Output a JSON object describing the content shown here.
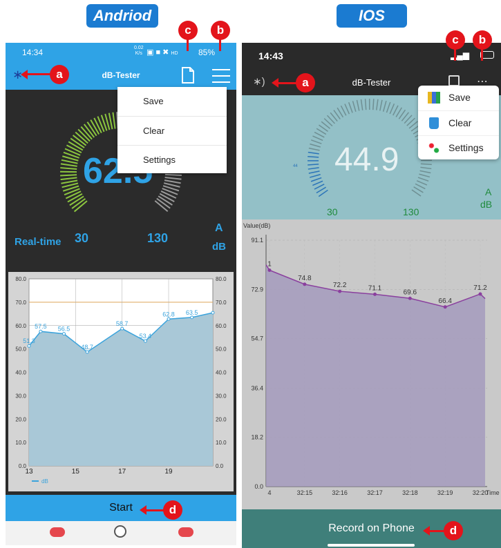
{
  "header": {
    "android_label": "Andriod",
    "ios_label": "IOS"
  },
  "markers": {
    "a": "a",
    "b": "b",
    "c": "c",
    "d": "d"
  },
  "android": {
    "status_time": "14:34",
    "status_speed_value": "0.02",
    "status_speed_unit": "K/s",
    "status_battery": "85%",
    "app_title": "dB-Tester",
    "reading": "62.5",
    "mode_label": "Real-time",
    "scale_min": "30",
    "scale_max": "130",
    "weighting": "A",
    "unit": "dB",
    "menu": [
      "Save",
      "Clear",
      "Settings"
    ],
    "start_label": "Start",
    "legend_label": "dB",
    "colors": {
      "accent": "#2fa3e6",
      "gauge_green": "#8cc63f",
      "line": "#3aa3dc"
    }
  },
  "ios": {
    "status_time": "14:43",
    "app_title": "dB-Tester",
    "reading": "44.9",
    "gauge_small_label": "44",
    "scale_min": "30",
    "scale_max": "130",
    "weighting": "A",
    "unit": "dB",
    "menu": [
      "Save",
      "Clear",
      "Settings"
    ],
    "record_label": "Record on Phone",
    "colors": {
      "accent": "#3f7f7a",
      "gauge_blue": "#2a73b8",
      "line": "#8a3f9e"
    }
  },
  "chart_data": [
    {
      "type": "area",
      "title": "",
      "ylabel": "",
      "xlabel": "",
      "ylim": [
        0,
        80
      ],
      "xlim": [
        13,
        20
      ],
      "y_ticks": [
        "0.0",
        "10.0",
        "20.0",
        "30.0",
        "40.0",
        "50.0",
        "60.0",
        "70.0",
        "80.0"
      ],
      "x_ticks": [
        "13",
        "15",
        "17",
        "19"
      ],
      "threshold": 70,
      "legend": "dB",
      "points": [
        {
          "x": 13.0,
          "y": 51.3,
          "label": "51.3"
        },
        {
          "x": 13.5,
          "y": 57.5,
          "label": "57.5"
        },
        {
          "x": 14.5,
          "y": 56.5,
          "label": "56.5"
        },
        {
          "x": 15.5,
          "y": 48.7,
          "label": "48.7"
        },
        {
          "x": 17.0,
          "y": 58.7,
          "label": "58.7"
        },
        {
          "x": 18.0,
          "y": 53.4,
          "label": "53.4"
        },
        {
          "x": 19.0,
          "y": 62.8,
          "label": "62.8"
        },
        {
          "x": 20.0,
          "y": 63.5,
          "label": "63.5"
        },
        {
          "x": 20.9,
          "y": 65.5,
          "label": ""
        }
      ]
    },
    {
      "type": "area",
      "title": "",
      "ylabel": "Value(dB)",
      "xlabel": "Time",
      "ylim": [
        0,
        91.1
      ],
      "y_ticks": [
        "0.0",
        "18.2",
        "36.4",
        "54.7",
        "72.9",
        "91.1"
      ],
      "x_ticks": [
        "4",
        "32:15",
        "32:16",
        "32:17",
        "32:18",
        "32:19",
        "32:20"
      ],
      "points": [
        {
          "x": "4",
          "y": 80.0,
          "label": "1"
        },
        {
          "x": "32:15",
          "y": 74.8,
          "label": "74.8"
        },
        {
          "x": "32:16",
          "y": 72.2,
          "label": "72.2"
        },
        {
          "x": "32:17",
          "y": 71.1,
          "label": "71.1"
        },
        {
          "x": "32:18",
          "y": 69.6,
          "label": "69.6"
        },
        {
          "x": "32:19",
          "y": 66.4,
          "label": "66.4"
        },
        {
          "x": "32:20",
          "y": 71.2,
          "label": "71.2"
        }
      ]
    }
  ]
}
